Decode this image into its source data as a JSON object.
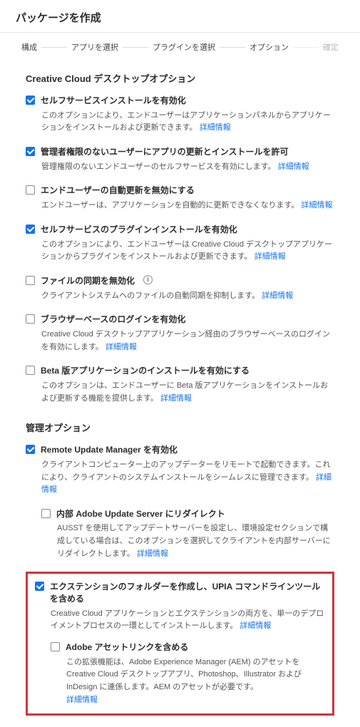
{
  "page": {
    "title": "パッケージを作成"
  },
  "stepper": {
    "s1": "構成",
    "s2": "アプリを選択",
    "s3": "プラグインを選択",
    "s4": "オプション",
    "s5": "確定"
  },
  "section_cc": {
    "title": "Creative Cloud デスクトップオプション"
  },
  "opt1": {
    "label": "セルフサービスインストールを有効化",
    "desc": "このオプションにより、エンドユーザーはアプリケーションパネルからアプリケーションをインストールおよび更新できます。",
    "more": "詳細情報"
  },
  "opt2": {
    "label": "管理者権限のないユーザーにアプリの更新とインストールを許可",
    "desc": "管理権限のないエンドユーザーのセルフサービスを有効にします。",
    "more": "詳細情報"
  },
  "opt3": {
    "label": "エンドユーザーの自動更新を無効にする",
    "desc": "エンドユーザーは、アプリケーションを自動的に更新できなくなります。",
    "more": "詳細情報"
  },
  "opt4": {
    "label": "セルフサービスのプラグインインストールを有効化",
    "desc": "このオプションにより、エンドユーザーは Creative Cloud デスクトップアプリケーションからプラグインをインストールおよび更新できます。",
    "more": "詳細情報"
  },
  "opt5": {
    "label": "ファイルの同期を無効化",
    "desc": "クライアントシステムへのファイルの自動同期を抑制します。",
    "more": "詳細情報"
  },
  "opt6": {
    "label": "ブラウザーベースのログインを有効化",
    "desc": "Creative Cloud デスクトップアプリケーション経由のブラウザーベースのログインを有効にします。",
    "more": "詳細情報"
  },
  "opt7": {
    "label": "Beta 版アプリケーションのインストールを有効にする",
    "desc": "このオプションは、エンドユーザーに Beta 版アプリケーションをインストールおよび更新する機能を提供します。",
    "more": "詳細情報"
  },
  "section_mgmt": {
    "title": "管理オプション"
  },
  "opt8": {
    "label": "Remote Update Manager を有効化",
    "desc": "クライアントコンピューター上のアップデーターをリモートで起動できます。これにより、クライアントのシステムインストールをシームレスに管理できます。",
    "more": "詳細情報"
  },
  "opt9": {
    "label": "内部 Adobe Update Server にリダイレクト",
    "desc": "AUSST を使用してアップデートサーバーを設定し、環境設定セクションで構成している場合は、このオプションを選択してクライアントを内部サーバーにリダイレクトします。",
    "more": "詳細情報"
  },
  "opt10": {
    "label": "エクステンションのフォルダーを作成し、UPIA コマンドラインツールを含める",
    "desc": "Creative Cloud アプリケーションとエクステンションの両方を、単一のデプロイメントプロセスの一環としてインストールします。",
    "more": "詳細情報"
  },
  "opt11": {
    "label": "Adobe アセットリンクを含める",
    "desc": "この拡張機能は、Adobe Experience Manager (AEM) のアセットを Creative Cloud デスクトップアプリ、Photoshop、Illustrator および InDesign に連係します。AEM のアセットが必要です。",
    "more": "詳細情報"
  }
}
